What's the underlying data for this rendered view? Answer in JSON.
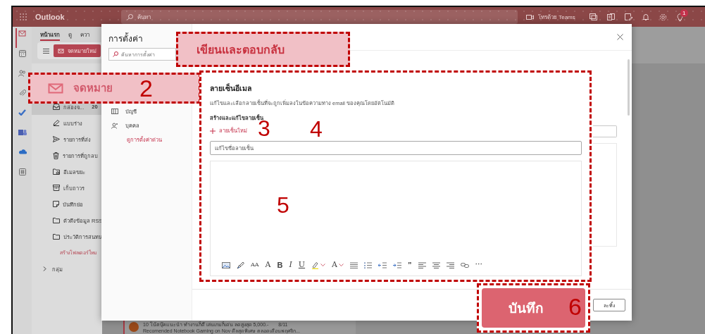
{
  "app": {
    "name": "Outlook",
    "search_placeholder": "ค้นหา",
    "teams_call": "โทรด้วย Teams",
    "notification_count": "1"
  },
  "rail": [
    {
      "kind": "mail",
      "selected": true
    },
    {
      "kind": "calendar",
      "selected": false
    },
    {
      "kind": "people",
      "selected": false
    },
    {
      "kind": "attach",
      "selected": false
    },
    {
      "kind": "todo",
      "selected": false
    },
    {
      "kind": "teams",
      "selected": false
    },
    {
      "kind": "cloud",
      "selected": false
    },
    {
      "kind": "apps",
      "selected": false
    }
  ],
  "ribbon": {
    "tabs": [
      {
        "label": "หน้าแรก",
        "selected": true
      },
      {
        "label": "ดู",
        "selected": false
      },
      {
        "label": "ควา",
        "selected": false
      }
    ],
    "new_mail": "จดหมายใหม่"
  },
  "folders": [
    {
      "kind": "inbox",
      "label": "กล่องจ...",
      "count": "20",
      "selected": true
    },
    {
      "kind": "draft",
      "label": "แบบร่าง",
      "selected": false
    },
    {
      "kind": "sent",
      "label": "รายการที่ส่ง",
      "selected": false
    },
    {
      "kind": "deleted",
      "label": "รายการที่ถูกลบ",
      "selected": false
    },
    {
      "kind": "junk",
      "label": "อีเมลขยะ",
      "selected": false
    },
    {
      "kind": "archive",
      "label": "เก็บถาวร",
      "selected": false
    },
    {
      "kind": "notes",
      "label": "บันทึกย่อ",
      "selected": false
    },
    {
      "kind": "folder",
      "label": "ตัวดึงข้อมูล RSS",
      "selected": false
    },
    {
      "kind": "folder",
      "label": "ประวัติการสนทน",
      "selected": false
    },
    {
      "kind": "action",
      "label": "สร้างโฟลเดอร์ใหม",
      "selected": false
    },
    {
      "kind": "group",
      "label": "กลุ่ม",
      "selected": false
    }
  ],
  "message": {
    "subject": "10 โน้ตบุ๊คแนะนำ ทำงานก็ดี เล่นเกมก็เด่น ลดสูงสุด 5,000.-",
    "date": "8/11",
    "preview": "Recomended Notebook Gaming on Nov ดีลสุดพิเศษ ตลอดเดือนพฤศจิก..."
  },
  "settings_dialog": {
    "title": "การตั้งค่า",
    "search_placeholder": "ค้นหาการตั้งค่า",
    "nav_items": [
      {
        "kind": "account",
        "label": "บัญชี"
      },
      {
        "kind": "people",
        "label": "บุคคล"
      },
      {
        "kind": "link",
        "label": "ดูการตั้งค่าด่วน"
      }
    ],
    "discard_button": "ละทิ้ง"
  },
  "callout_section": {
    "label": "เขียนและตอบกลับ"
  },
  "callout_category": {
    "label": "จดหมาย",
    "number": "2"
  },
  "signature_panel": {
    "title": "ลายเซ็นอีเมล",
    "description": "แก้ไขและเลือกลายเซ็นที่จะถูกเพิ่มลงในข้อความทาง email ของคุณโดยอัตโนมัติ",
    "subheading": "สร้างและแก้ไขลายเซ็น",
    "new_signature": "ลายเซ็นใหม่",
    "name_placeholder": "แก้ไขชื่อลายเซ็น",
    "numbers": [
      "3",
      "4",
      "5"
    ],
    "toolbar": [
      {
        "kind": "image"
      },
      {
        "kind": "painter"
      },
      {
        "kind": "font-size",
        "glyph": "AA"
      },
      {
        "kind": "grow-font",
        "glyph": "A"
      },
      {
        "kind": "bold",
        "glyph": "B"
      },
      {
        "kind": "italic",
        "glyph": "I"
      },
      {
        "kind": "underline",
        "glyph": "U"
      },
      {
        "kind": "highlight"
      },
      {
        "kind": "font-color",
        "glyph": "A"
      },
      {
        "kind": "bullets"
      },
      {
        "kind": "numbering"
      },
      {
        "kind": "outdent"
      },
      {
        "kind": "indent"
      },
      {
        "kind": "quote",
        "glyph": "”"
      },
      {
        "kind": "align-left"
      },
      {
        "kind": "align-center"
      },
      {
        "kind": "align-right"
      },
      {
        "kind": "link"
      },
      {
        "kind": "more",
        "glyph": "···"
      }
    ]
  },
  "callout_save": {
    "label": "บันทึก",
    "number": "6"
  }
}
